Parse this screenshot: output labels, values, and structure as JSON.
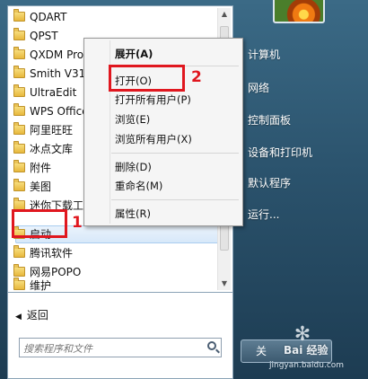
{
  "programs": [
    {
      "label": "QDART"
    },
    {
      "label": "QPST"
    },
    {
      "label": "QXDM Pro"
    },
    {
      "label": "Smith V31"
    },
    {
      "label": "UltraEdit"
    },
    {
      "label": "WPS Office"
    },
    {
      "label": "阿里旺旺"
    },
    {
      "label": "冰点文库"
    },
    {
      "label": "附件"
    },
    {
      "label": "美图"
    },
    {
      "label": "迷你下载工"
    },
    {
      "label": "启动"
    },
    {
      "label": "腾讯软件"
    },
    {
      "label": "网易POPO"
    },
    {
      "label": "维护"
    }
  ],
  "highlighted_program": "启动",
  "back_label": "返回",
  "search": {
    "placeholder": "搜索程序和文件"
  },
  "context_menu": {
    "items": [
      {
        "label": "展开(A)",
        "bold": true
      },
      {
        "label": "打开(O)"
      },
      {
        "label": "打开所有用户(P)"
      },
      {
        "label": "浏览(E)"
      },
      {
        "label": "浏览所有用户(X)"
      },
      {
        "label": "删除(D)"
      },
      {
        "label": "重命名(M)"
      },
      {
        "label": "属性(R)"
      }
    ]
  },
  "right_pane": {
    "items": [
      {
        "label": "计算机"
      },
      {
        "label": "网络"
      },
      {
        "label": "控制面板"
      },
      {
        "label": "设备和打印机"
      },
      {
        "label": "默认程序"
      },
      {
        "label": "运行..."
      }
    ]
  },
  "shutdown_label": "关",
  "annotations": {
    "marker1": "1",
    "marker2": "2",
    "color": "#e0171f"
  },
  "watermark": {
    "text": "Bai 经验",
    "url": "jingyan.baidu.com"
  }
}
